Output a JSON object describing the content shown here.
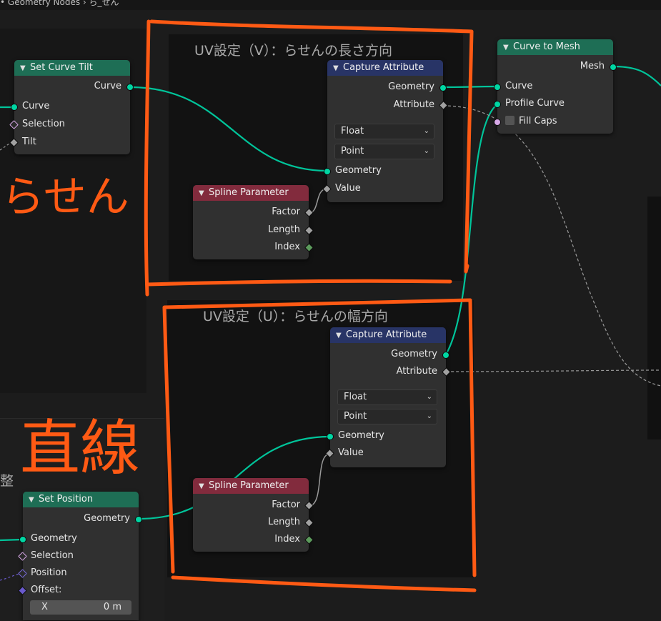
{
  "topbar": {
    "breadcrumb": "• Geometry Nodes  ›  ら_せん"
  },
  "frames": {
    "v_label": "UV設定（V）：らせんの長さ方向",
    "u_label": "UV設定（U）：らせんの幅方向",
    "partial_label": "整"
  },
  "annotations": {
    "spiral": "らせん",
    "straight": "直線"
  },
  "nodes": {
    "set_curve_tilt": {
      "title": "Set Curve Tilt",
      "output_curve": "Curve",
      "input_curve": "Curve",
      "input_selection": "Selection",
      "input_tilt": "Tilt"
    },
    "capture_v": {
      "title": "Capture Attribute",
      "output_geometry": "Geometry",
      "output_attribute": "Attribute",
      "data_type": "Float",
      "domain": "Point",
      "input_geometry": "Geometry",
      "input_value": "Value"
    },
    "spline_param_v": {
      "title": "Spline Parameter",
      "output_factor": "Factor",
      "output_length": "Length",
      "output_index": "Index"
    },
    "curve_to_mesh": {
      "title": "Curve to Mesh",
      "output_mesh": "Mesh",
      "input_curve": "Curve",
      "input_profile": "Profile Curve",
      "input_fill_caps": "Fill Caps"
    },
    "capture_u": {
      "title": "Capture Attribute",
      "output_geometry": "Geometry",
      "output_attribute": "Attribute",
      "data_type": "Float",
      "domain": "Point",
      "input_geometry": "Geometry",
      "input_value": "Value"
    },
    "spline_param_u": {
      "title": "Spline Parameter",
      "output_factor": "Factor",
      "output_length": "Length",
      "output_index": "Index"
    },
    "set_position": {
      "title": "Set Position",
      "output_geometry": "Geometry",
      "input_geometry": "Geometry",
      "input_selection": "Selection",
      "input_position": "Position",
      "input_offset": "Offset:",
      "offset_x_label": "X",
      "offset_x_value": "0 m"
    }
  },
  "colors": {
    "annotation_orange": "#ff5a14",
    "geometry_wire": "#00c49a",
    "float_wire": "#9a9a9a",
    "header_geometry": "#1e6e55",
    "header_attribute": "#283466",
    "header_input": "#822b3d"
  }
}
